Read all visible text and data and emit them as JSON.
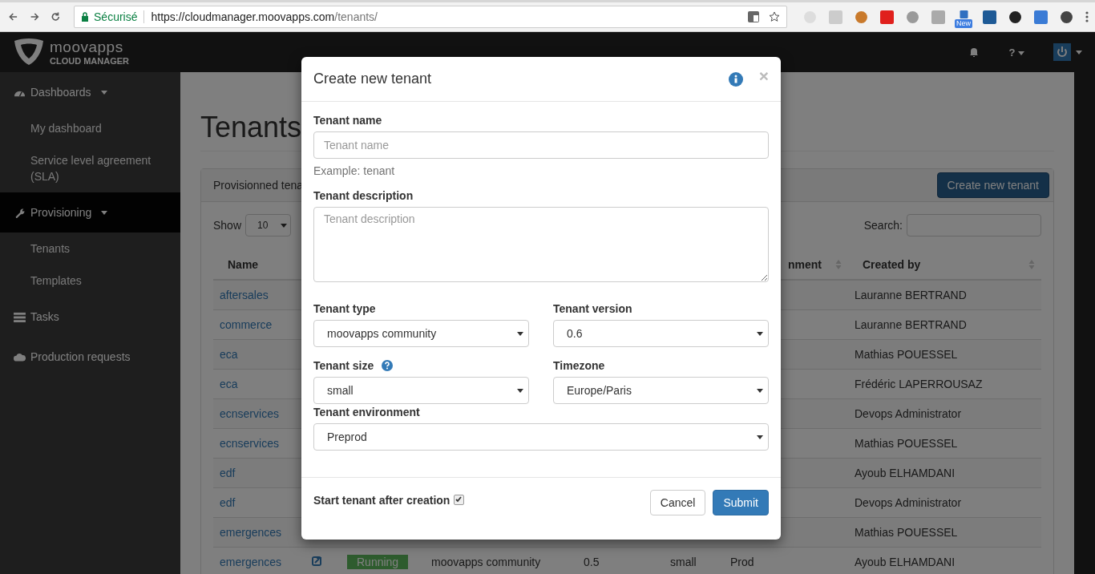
{
  "browser": {
    "security_label": "Sécurisé",
    "url_host": "https://cloudmanager.moovapps.com",
    "url_path": "/tenants/",
    "extension_badge": "New"
  },
  "navbar": {
    "brand_name": "moovapps",
    "brand_sub": "CLOUD MANAGER",
    "help_label": "?"
  },
  "sidebar": {
    "items": [
      {
        "label": "Dashboards",
        "selected": false,
        "expanded": true,
        "children": [
          {
            "label": "My dashboard",
            "selected": false
          },
          {
            "label": "Service level agreement (SLA)",
            "selected": false
          }
        ]
      },
      {
        "label": "Provisioning",
        "selected": true,
        "expanded": true,
        "children": [
          {
            "label": "Tenants",
            "selected": false
          },
          {
            "label": "Templates",
            "selected": false
          }
        ]
      },
      {
        "label": "Tasks",
        "selected": false
      },
      {
        "label": "Production requests",
        "selected": false
      }
    ]
  },
  "page": {
    "title": "Tenants",
    "panel_title": "Provisionned tena",
    "create_button": "Create new tenant",
    "show_label": "Show",
    "page_size": "10",
    "search_label": "Search:",
    "columns": [
      {
        "label": "Name"
      },
      {},
      {},
      {},
      {},
      {},
      {
        "label": "nment",
        "sortable": true
      },
      {
        "label": "Created by",
        "sortable": true
      }
    ],
    "rows": [
      {
        "name": "aftersales",
        "created_by": "Lauranne BERTRAND"
      },
      {
        "name": "commerce",
        "created_by": "Lauranne BERTRAND"
      },
      {
        "name": "eca",
        "created_by": "Mathias POUESSEL"
      },
      {
        "name": "eca",
        "created_by": "Frédéric LAPERROUSAZ"
      },
      {
        "name": "ecnservices",
        "created_by": "Devops Administrator"
      },
      {
        "name": "ecnservices",
        "created_by": "Mathias POUESSEL"
      },
      {
        "name": "edf",
        "created_by": "Ayoub ELHAMDANI"
      },
      {
        "name": "edf",
        "created_by": "Devops Administrator"
      },
      {
        "name": "emergences",
        "created_by": "Mathias POUESSEL"
      },
      {
        "name": "emergences",
        "status": "Running",
        "type": "moovapps community",
        "version": "0.5",
        "size": "small",
        "environment": "Prod",
        "created_by": "Ayoub ELHAMDANI"
      }
    ]
  },
  "modal": {
    "title": "Create new tenant",
    "close": "×",
    "rows": [
      [
        {
          "kind": "text",
          "label": "Tenant name",
          "placeholder": "Tenant name",
          "help": "Example: tenant"
        }
      ],
      [
        {
          "kind": "textarea",
          "label": "Tenant description",
          "placeholder": "Tenant description"
        }
      ],
      [
        {
          "kind": "select",
          "label": "Tenant type",
          "value": "moovapps community"
        },
        {
          "kind": "select",
          "label": "Tenant version",
          "value": "0.6"
        }
      ],
      [
        {
          "kind": "select",
          "label": "Tenant size",
          "value": "small",
          "info": true
        },
        {
          "kind": "select",
          "label": "Timezone",
          "value": "Europe/Paris"
        }
      ],
      [
        {
          "kind": "select",
          "label": "Tenant environment",
          "value": "Preprod"
        }
      ]
    ],
    "start_label": "Start tenant after creation",
    "start_checked": true,
    "buttons": [
      {
        "label": "Cancel",
        "kind": "default"
      },
      {
        "label": "Submit",
        "kind": "primary"
      }
    ]
  }
}
